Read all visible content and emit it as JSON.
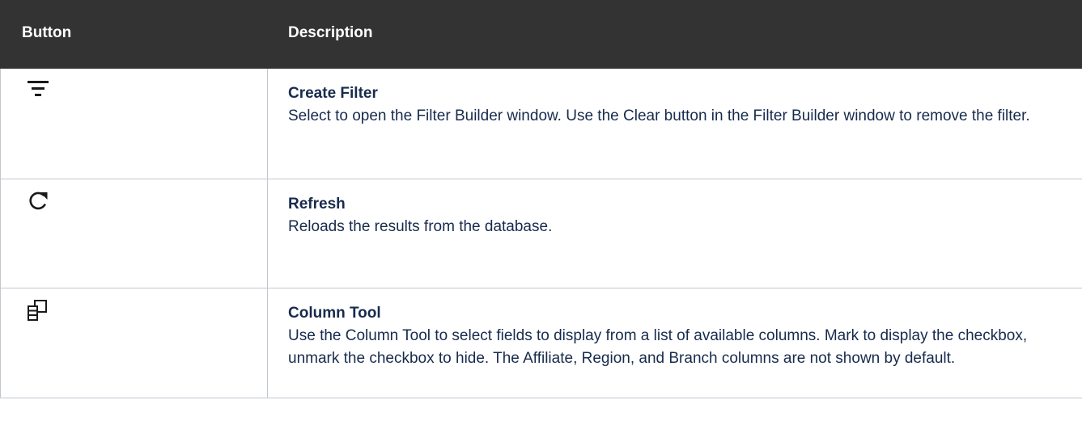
{
  "table": {
    "headers": {
      "button": "Button",
      "description": "Description"
    },
    "rows": [
      {
        "icon": "filter-icon",
        "title": "Create Filter",
        "description": "Select to open the Filter Builder window. Use the Clear button in the Filter Builder window to remove the filter."
      },
      {
        "icon": "refresh-icon",
        "title": "Refresh",
        "description": "Reloads the results from the database."
      },
      {
        "icon": "column-tool-icon",
        "title": "Column Tool",
        "description": "Use the Column Tool to select fields to display from a list of available columns. Mark to display the checkbox, unmark the checkbox to hide. The Affiliate, Region, and Branch columns are not shown by default."
      }
    ]
  },
  "colors": {
    "header_background": "#333333",
    "header_text": "#ffffff",
    "body_text": "#172b4d",
    "border": "#c1c7d0",
    "icon": "#1a1a1a"
  }
}
